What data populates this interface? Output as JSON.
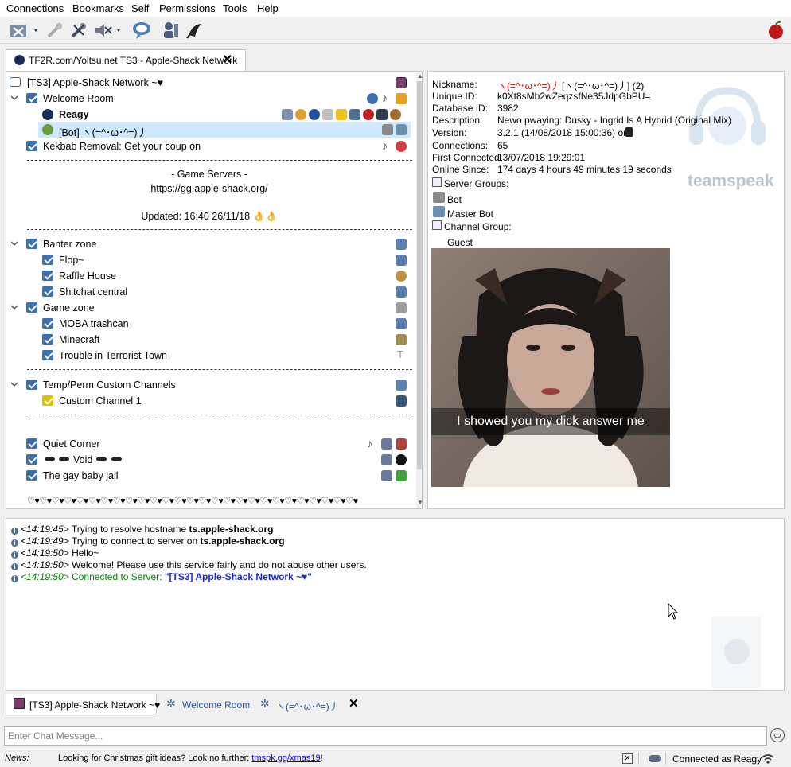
{
  "menu": [
    "Connections",
    "Bookmarks",
    "Self",
    "Permissions",
    "Tools",
    "Help"
  ],
  "toolbar": {
    "items": [
      "connect-icon",
      "disconnect-icon",
      "mute-microphone-icon",
      "mute-speakers-icon",
      "away-icon",
      "contacts-icon",
      "avatar-icon",
      "whisper-icon"
    ],
    "brand_icon": "apple-icon"
  },
  "server_tab": {
    "label": "TF2R.com/Yoitsu.net TS3 - Apple-Shack Network"
  },
  "tree": {
    "server_name": "[TS3] Apple-Shack Network ~♥",
    "welcome_room": "Welcome Room",
    "user_reagy": "Reagy",
    "user_bot": "[Bot] ヽ(=^･ω･^=)丿",
    "kekbab": "Kekbab Removal: Get your coup on",
    "game_servers_title": "- Game Servers -",
    "game_servers_url": "https://gg.apple-shack.org/",
    "updated": "Updated: 16:40 26/11/18 👌👌",
    "banter": "Banter zone",
    "flop": "Flop~",
    "raffle": "Raffle House",
    "shitchat": "Shitchat central",
    "game_zone": "Game zone",
    "moba": "MOBA trashcan",
    "minecraft": "Minecraft",
    "ttt": "Trouble in Terrorist Town",
    "temp_perm": "Temp/Perm Custom Channels",
    "custom1": "Custom Channel 1",
    "quiet": "Quiet Corner",
    "void_text": "Void",
    "gay_baby": "The gay baby jail",
    "hearts": "♡♥♡♥♡♥♡♥♡♥♡♥♡♥♡♥♡♥♡♥♡♥♡♥♡♥♡♥♡♥♡♥♡♥♡♥♡♥♡♥♡♥♡♥♡♥♡♥♡♥♡♥♡♥"
  },
  "info": {
    "nickname_label": "Nickname:",
    "nickname_value": "ヽ(=^･ω･^=)丿",
    "nickname_alt": "[ヽ(=^･ω･^=)丿] (2)",
    "uid_label": "Unique ID:",
    "uid_value": "k0Xt8sMb2wZeqzsfNe35JdpGbPU=",
    "dbid_label": "Database ID:",
    "dbid_value": "3982",
    "desc_label": "Description:",
    "desc_value": "Newo pwaying: Dusky - Ingrid Is A Hybrid (Original Mix)",
    "version_label": "Version:",
    "version_value": "3.2.1 (14/08/2018 15:00:36) on",
    "connections_label": "Connections:",
    "connections_value": "65",
    "first_label": "First Connected:",
    "first_value": "13/07/2018 19:29:01",
    "online_label": "Online Since:",
    "online_value": "174 days 4 hours 49 minutes 19 seconds",
    "server_groups_label": "Server Groups:",
    "group_bot": "Bot",
    "group_master": "Master Bot",
    "channel_group_label": "Channel Group:",
    "channel_group_value": "Guest",
    "watermark": "teamspeak",
    "avatar_caption": "I showed you my dick answer me"
  },
  "log": [
    {
      "time": "<14:19:45>",
      "text": "Trying to resolve hostname ",
      "bold": "ts.apple-shack.org"
    },
    {
      "time": "<14:19:49>",
      "text": "Trying to connect to server on ",
      "bold": "ts.apple-shack.org"
    },
    {
      "time": "<14:19:50>",
      "text": "Hello~",
      "bold": ""
    },
    {
      "time": "<14:19:50>",
      "text": "Welcome! Please use this service fairly and do not abuse other users.",
      "bold": ""
    },
    {
      "time": "<14:19:50>",
      "text": "Connected to Server: ",
      "bold": "\"[TS3] Apple-Shack Network ~♥\""
    }
  ],
  "chat_tabs": [
    "[TS3] Apple-Shack Network ~♥",
    "Welcome Room",
    "ヽ(=^･ω･^=)丿"
  ],
  "chat_input": {
    "placeholder": "Enter Chat Message..."
  },
  "status": {
    "news_label": "News:",
    "news_text": "Looking for Christmas gift ideas? Look no further: ",
    "news_link": "tmspk.gg/xmas19",
    "news_suffix": "!",
    "connected_as": "Connected as Reagy"
  },
  "colors": {
    "selection": "#cde8ff",
    "channel_icon": "#3c6fb0",
    "link": "#0000ff",
    "connected_green": "#008000",
    "nickname_red": "#e00000"
  }
}
